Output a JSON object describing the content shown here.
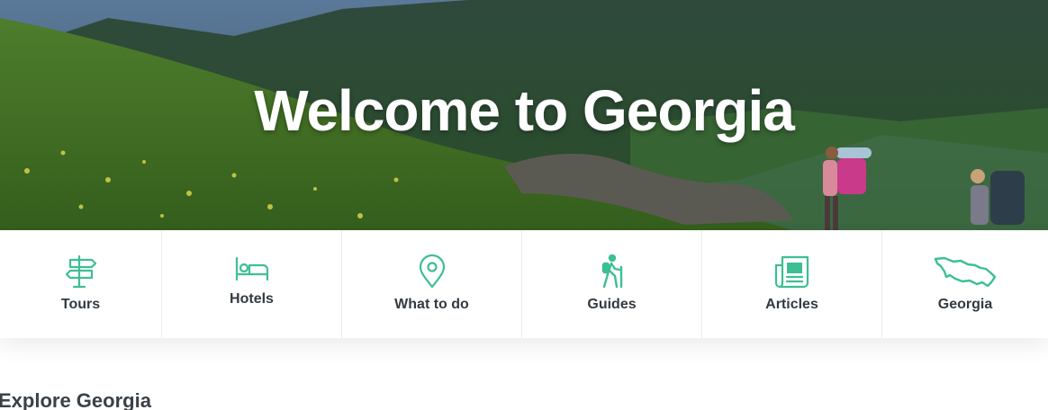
{
  "hero": {
    "title": "Welcome to Georgia",
    "image": "mountain-meadow-hikers-photo"
  },
  "nav": {
    "items": [
      {
        "label": "Tours",
        "icon": "signpost-icon"
      },
      {
        "label": "Hotels",
        "icon": "bed-icon"
      },
      {
        "label": "What to do",
        "icon": "map-pin-icon"
      },
      {
        "label": "Guides",
        "icon": "hiker-icon"
      },
      {
        "label": "Articles",
        "icon": "newspaper-icon"
      },
      {
        "label": "Georgia",
        "icon": "georgia-map-icon"
      }
    ],
    "accent_color": "#3dbf93"
  },
  "section": {
    "title": "Explore Georgia"
  }
}
